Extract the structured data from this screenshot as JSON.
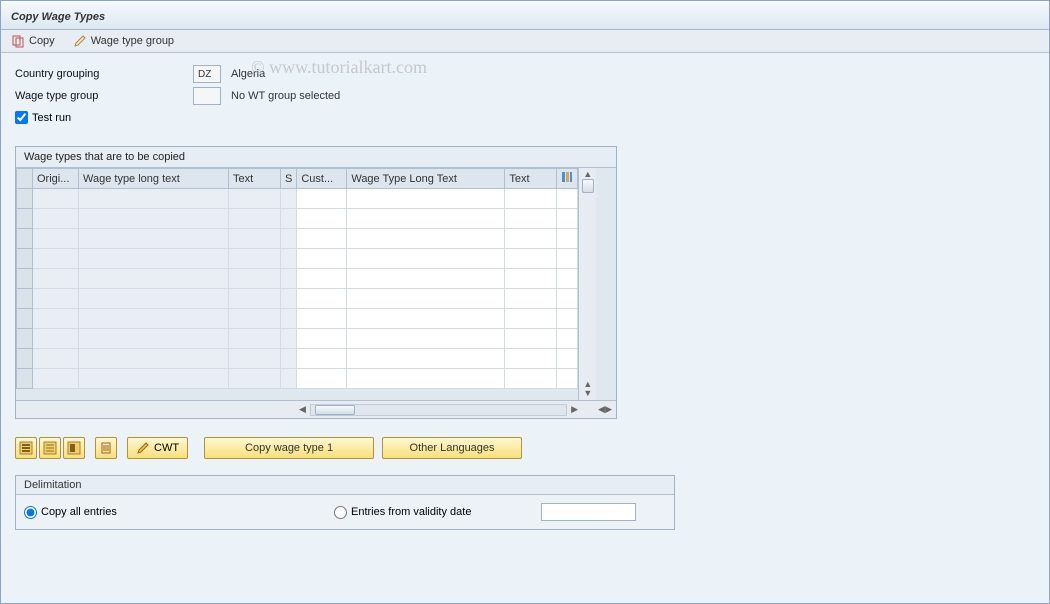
{
  "title": "Copy Wage Types",
  "toolbar": {
    "copy_label": "Copy",
    "wtg_label": "Wage type group"
  },
  "fields": {
    "country_label": "Country grouping",
    "country_code": "DZ",
    "country_name": "Algeria",
    "wtg_label": "Wage type group",
    "wtg_value": "",
    "wtg_desc": "No WT group selected",
    "test_run_label": "Test run",
    "test_run_checked": true
  },
  "grid": {
    "title": "Wage types that are to be copied",
    "columns": [
      "Origi...",
      "Wage type long text",
      "Text",
      "S",
      "Cust...",
      "Wage Type Long Text",
      "Text"
    ],
    "row_count": 10
  },
  "buttons": {
    "cwt": "CWT",
    "copy_wt1": "Copy wage type 1",
    "other_lang": "Other Languages"
  },
  "delimitation": {
    "title": "Delimitation",
    "opt_all": "Copy all entries",
    "opt_from": "Entries from validity date",
    "selected": "all"
  },
  "watermark": "© www.tutorialkart.com"
}
